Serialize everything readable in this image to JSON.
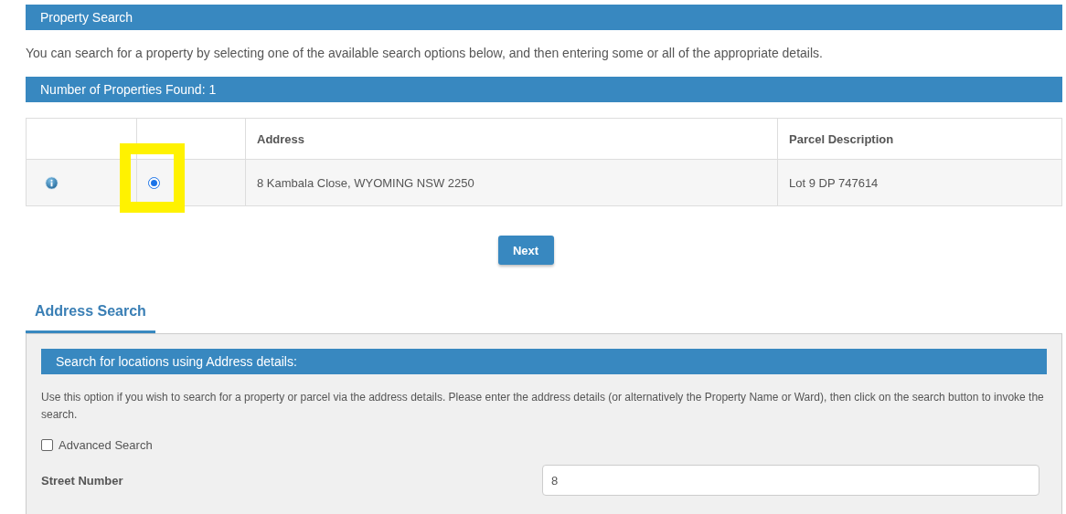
{
  "header": {
    "title": "Property Search"
  },
  "intro": "You can search for a property by selecting one of the available search options below, and then entering some or all of the appropriate details.",
  "results": {
    "title": "Number of Properties Found: 1",
    "columns": [
      "Address",
      "Parcel Description"
    ],
    "rows": [
      {
        "selected": true,
        "address": "8 Kambala Close, WYOMING NSW 2250",
        "parcel": "Lot 9 DP 747614"
      }
    ]
  },
  "next_button": "Next",
  "tabs": [
    {
      "label": "Address Search",
      "selected": true
    }
  ],
  "panel": {
    "title": "Search for locations using Address details:",
    "description": "Use this option if you wish to search for a property or parcel via the address details. Please enter the address details (or alternatively the Property Name or Ward), then click on the search button to invoke the search.",
    "advanced": {
      "label": "Advanced Search",
      "checked": false
    },
    "fields": [
      {
        "label": "Street Number",
        "value": "8"
      }
    ]
  }
}
